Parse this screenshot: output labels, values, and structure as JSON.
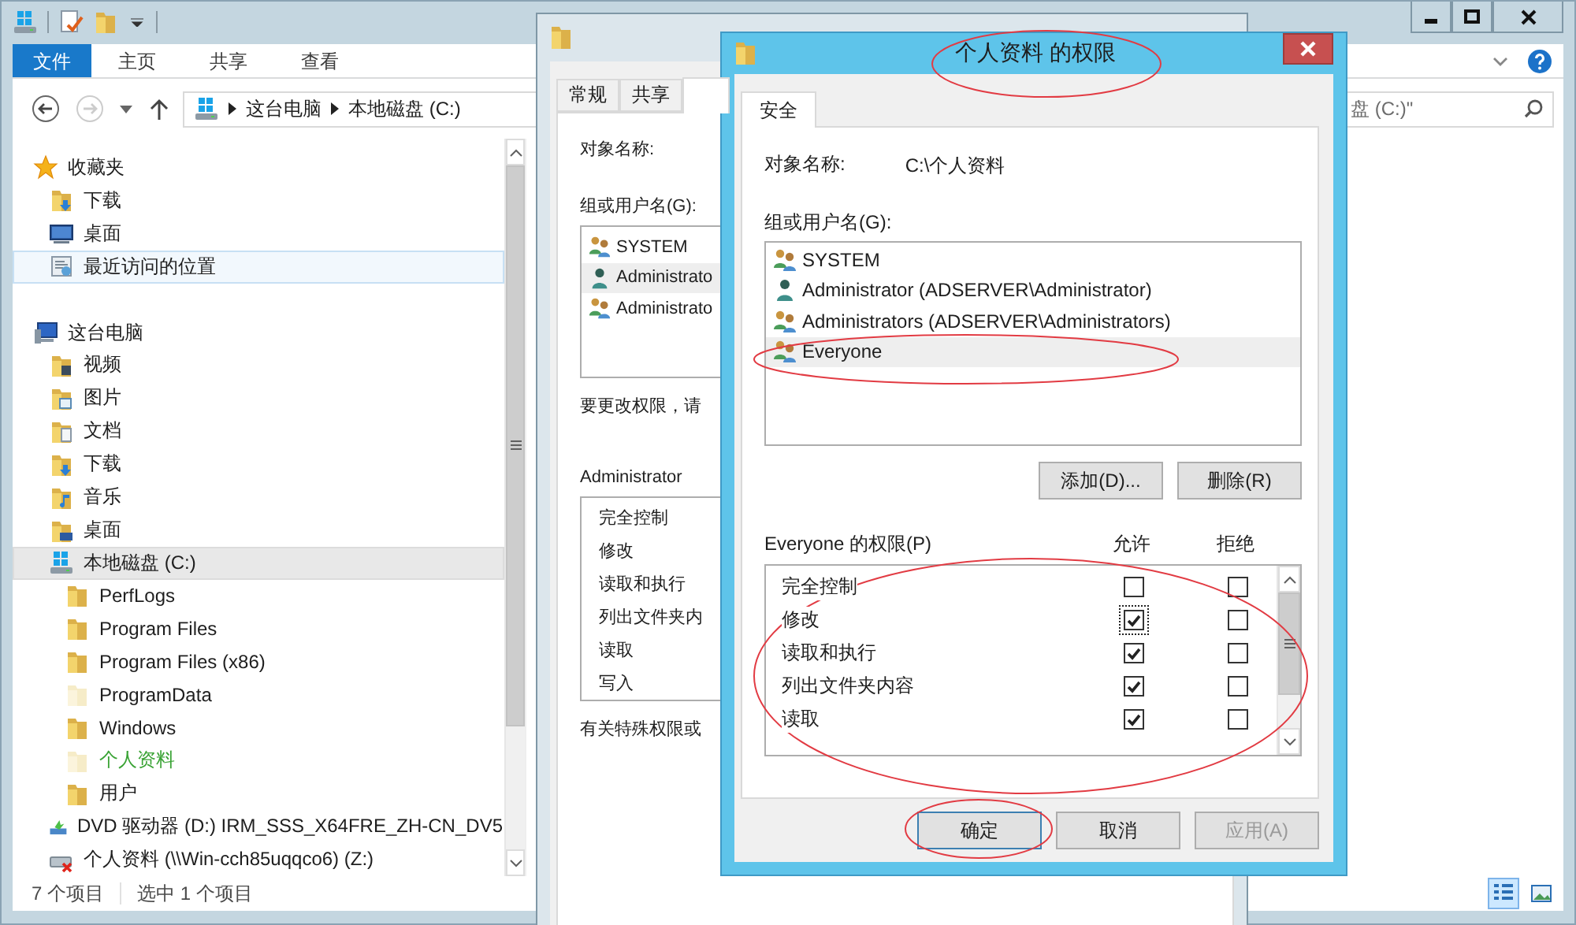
{
  "explorer": {
    "ribbon_tabs": [
      {
        "label": "文件",
        "kind": "file",
        "selected": false
      },
      {
        "label": "主页",
        "kind": "tab",
        "selected": false
      },
      {
        "label": "共享",
        "kind": "tab",
        "selected": false
      },
      {
        "label": "查看",
        "kind": "tab",
        "selected": false
      }
    ],
    "address": {
      "crumbs": [
        "这台电脑",
        "本地磁盘 (C:)"
      ]
    },
    "search": {
      "placeholder": "盘 (C:)\""
    },
    "nav_tree": [
      {
        "label": "收藏夹",
        "kind": "favorites",
        "selected": false,
        "hovered": false,
        "children": [
          {
            "label": "下载",
            "kind": "downloads",
            "selected": false,
            "hovered": false
          },
          {
            "label": "桌面",
            "kind": "desktop",
            "selected": false,
            "hovered": false
          },
          {
            "label": "最近访问的位置",
            "kind": "recent",
            "selected": false,
            "hovered": true
          }
        ]
      },
      {
        "label": "这台电脑",
        "kind": "computer",
        "selected": false,
        "hovered": false,
        "children": [
          {
            "label": "视频",
            "kind": "videos",
            "selected": false,
            "hovered": false
          },
          {
            "label": "图片",
            "kind": "pictures",
            "selected": false,
            "hovered": false
          },
          {
            "label": "文档",
            "kind": "documents",
            "selected": false,
            "hovered": false
          },
          {
            "label": "下载",
            "kind": "downloads",
            "selected": false,
            "hovered": false
          },
          {
            "label": "音乐",
            "kind": "music",
            "selected": false,
            "hovered": false
          },
          {
            "label": "桌面",
            "kind": "desktop-folder",
            "selected": false,
            "hovered": false
          },
          {
            "label": "本地磁盘 (C:)",
            "kind": "drive",
            "selected": true,
            "hovered": false,
            "children": [
              {
                "label": "PerfLogs",
                "kind": "folder",
                "selected": false,
                "hovered": false
              },
              {
                "label": "Program Files",
                "kind": "folder",
                "selected": false,
                "hovered": false
              },
              {
                "label": "Program Files (x86)",
                "kind": "folder",
                "selected": false,
                "hovered": false
              },
              {
                "label": "ProgramData",
                "kind": "hidden-folder",
                "selected": false,
                "hovered": false
              },
              {
                "label": "Windows",
                "kind": "folder",
                "selected": false,
                "hovered": false
              },
              {
                "label": "个人资料",
                "kind": "hidden-folder",
                "selected": false,
                "hovered": false,
                "color": "#3aa335"
              },
              {
                "label": "用户",
                "kind": "folder",
                "selected": false,
                "hovered": false
              }
            ]
          },
          {
            "label": "DVD 驱动器 (D:) IRM_SSS_X64FRE_ZH-CN_DV5",
            "kind": "dvd",
            "selected": false,
            "hovered": false
          },
          {
            "label": "个人资料 (\\\\Win-cch85uqqco6) (Z:)",
            "kind": "network-drive",
            "selected": false,
            "hovered": false
          }
        ]
      }
    ],
    "status_bar": {
      "count": "7 个项目",
      "selection": "选中 1 个项目"
    }
  },
  "properties_dialog": {
    "tabs": [
      {
        "label": "常规",
        "selected": false
      },
      {
        "label": "共享",
        "selected": false
      }
    ],
    "object_label": "对象名称:",
    "group_label": "组或用户名(G):",
    "users": [
      {
        "name": "SYSTEM",
        "kind": "group",
        "selected": false
      },
      {
        "name": "Administrato",
        "kind": "user",
        "selected": true
      },
      {
        "name": "Administrato",
        "kind": "group",
        "selected": false
      }
    ],
    "hint": "要更改权限，请",
    "perm_label": "Administrator",
    "permissions": [
      "完全控制",
      "修改",
      "读取和执行",
      "列出文件夹内",
      "读取",
      "写入"
    ],
    "footer": "有关特殊权限或"
  },
  "permission_dialog": {
    "title": "个人资料 的权限",
    "tabs": [
      {
        "label": "安全",
        "selected": true
      }
    ],
    "object_label": "对象名称:",
    "object_value": "C:\\个人资料",
    "group_label": "组或用户名(G):",
    "users": [
      {
        "name": "SYSTEM",
        "kind": "group",
        "selected": false
      },
      {
        "name": "Administrator (ADSERVER\\Administrator)",
        "kind": "user",
        "selected": false
      },
      {
        "name": "Administrators (ADSERVER\\Administrators)",
        "kind": "group",
        "selected": false
      },
      {
        "name": "Everyone",
        "kind": "group",
        "selected": true
      }
    ],
    "add_button": "添加(D)...",
    "remove_button": "删除(R)",
    "perm_label": "Everyone 的权限(P)",
    "allow_label": "允许",
    "deny_label": "拒绝",
    "permissions": [
      {
        "name": "完全控制",
        "allow": false,
        "deny": false,
        "focused": false
      },
      {
        "name": "修改",
        "allow": true,
        "deny": false,
        "focused": true
      },
      {
        "name": "读取和执行",
        "allow": true,
        "deny": false,
        "focused": false
      },
      {
        "name": "列出文件夹内容",
        "allow": true,
        "deny": false,
        "focused": false
      },
      {
        "name": "读取",
        "allow": true,
        "deny": false,
        "focused": false
      }
    ],
    "buttons": [
      {
        "label": "确定",
        "kind": "default",
        "disabled": false
      },
      {
        "label": "取消",
        "kind": "normal",
        "disabled": false
      },
      {
        "label": "应用(A)",
        "kind": "normal",
        "disabled": true
      }
    ]
  },
  "annotations": [
    {
      "kind": "title"
    },
    {
      "kind": "user"
    },
    {
      "kind": "permissions"
    },
    {
      "kind": "ok"
    }
  ]
}
